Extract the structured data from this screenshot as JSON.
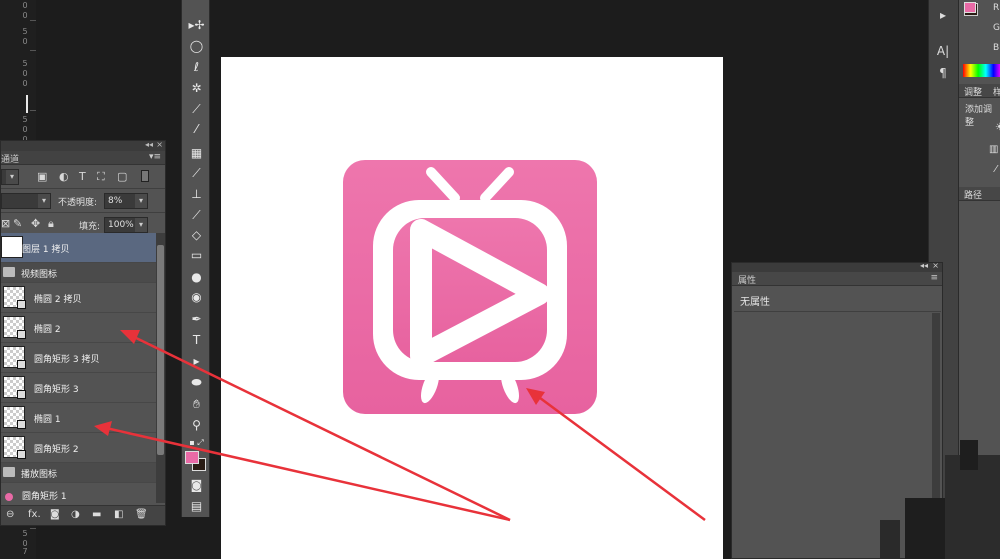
{
  "ruler": {
    "ticks_top": [
      "0",
      "0",
      "5",
      "0"
    ],
    "ticks_mid": [
      "5",
      "0",
      "0",
      "5",
      "0",
      "0"
    ],
    "ticks_bottom": [
      "5",
      "0",
      "7",
      "5"
    ]
  },
  "layers_panel": {
    "collapse_glyph": "◂◂",
    "close_glyph": "×",
    "tab_label": "通道",
    "menu_glyph": "▾≡",
    "opacity_label": "不透明度:",
    "opacity_value": "8%",
    "fill_label": "填充:",
    "fill_value": "100%",
    "layers": [
      {
        "name": "图层 1 拷贝",
        "kind": "layer",
        "selected": true
      },
      {
        "name": "视频图标",
        "kind": "group"
      },
      {
        "name": "椭圆 2 拷贝",
        "kind": "shape"
      },
      {
        "name": "椭圆 2",
        "kind": "shape"
      },
      {
        "name": "圆角矩形 3 拷贝",
        "kind": "shape"
      },
      {
        "name": "圆角矩形 3",
        "kind": "shape"
      },
      {
        "name": "椭圆 1",
        "kind": "shape"
      },
      {
        "name": "圆角矩形 2",
        "kind": "shape"
      },
      {
        "name": "播放图标",
        "kind": "group"
      },
      {
        "name": "圆角矩形 1",
        "kind": "shape"
      }
    ],
    "bottom_icons": [
      "link-icon",
      "fx-icon",
      "mask-icon",
      "adjustment-icon",
      "folder-icon",
      "new-layer-icon",
      "trash-icon"
    ],
    "fx_label": "fx."
  },
  "properties_panel": {
    "title": "属性",
    "content": "无属性",
    "collapse_glyph": "◂◂",
    "close_glyph": "×"
  },
  "right_panels": {
    "color_r_label": "R",
    "color_g_label": "G",
    "color_b_label": "B",
    "adjust_tab": "调整",
    "adjust_tab2": "样",
    "add_adjust": "添加调整",
    "paths_tab": "路径"
  },
  "colors": {
    "foreground": "#e96aa6",
    "background": "#2a1c14",
    "icon_pink": "#e96aa6",
    "arrow_red": "#e8323a"
  }
}
